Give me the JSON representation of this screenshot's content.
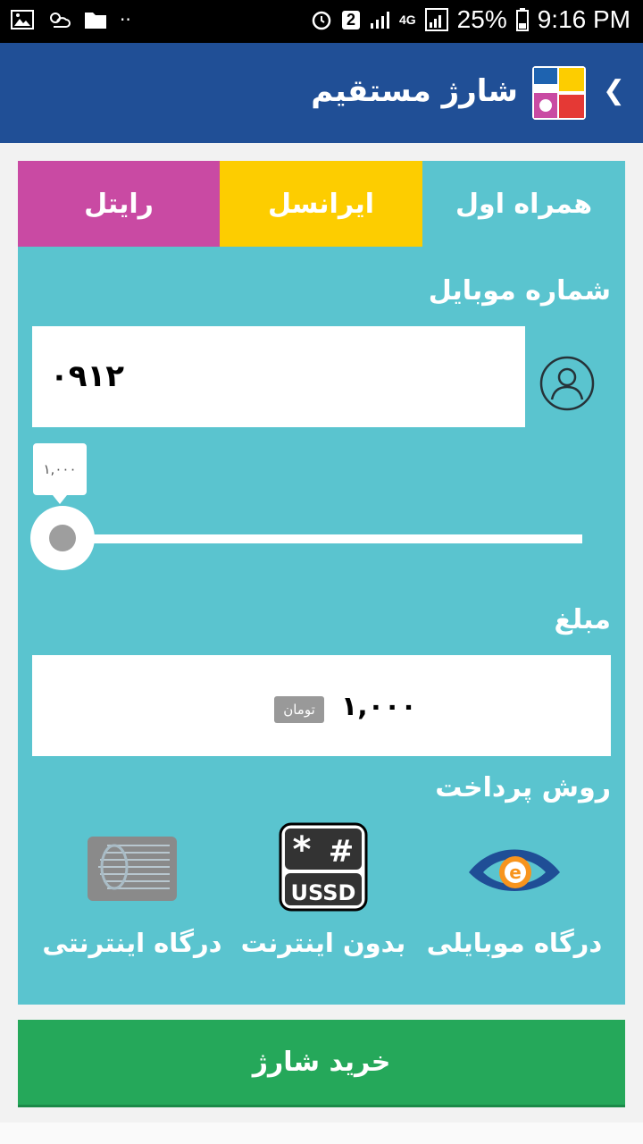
{
  "status_bar": {
    "badge": "2",
    "network": "4G",
    "battery": "25%",
    "time": "9:16 PM"
  },
  "app_bar": {
    "title": "شارژ مستقیم",
    "back_glyph": "❮",
    "logo_icon": "operators-logo-icon"
  },
  "operators": {
    "tabs": [
      {
        "label": "همراه اول",
        "color": "#5ac4cf"
      },
      {
        "label": "ایرانسل",
        "color": "#fdcd00"
      },
      {
        "label": "رایتل",
        "color": "#c94aa3"
      }
    ]
  },
  "mobile": {
    "label": "شماره موبایل",
    "value": "۰۹۱۲"
  },
  "slider": {
    "tooltip": "۱,۰۰۰",
    "value_fraction": 0
  },
  "amount": {
    "label": "مبلغ",
    "value": "۱,۰۰۰",
    "unit": "تومان"
  },
  "payment": {
    "label": "روش پرداخت",
    "methods": [
      {
        "label": "درگاه موبایلی",
        "icon": "e-payment-eye-icon"
      },
      {
        "label": "بدون اینترنت",
        "icon": "ussd-icon"
      },
      {
        "label": "درگاه اینترنتی",
        "icon": "bank-card-icon"
      }
    ]
  },
  "buy_button": {
    "label": "خرید شارژ"
  },
  "colors": {
    "app_bar": "#204f96",
    "panel": "#5ac4cf",
    "buy": "#25a85a"
  }
}
